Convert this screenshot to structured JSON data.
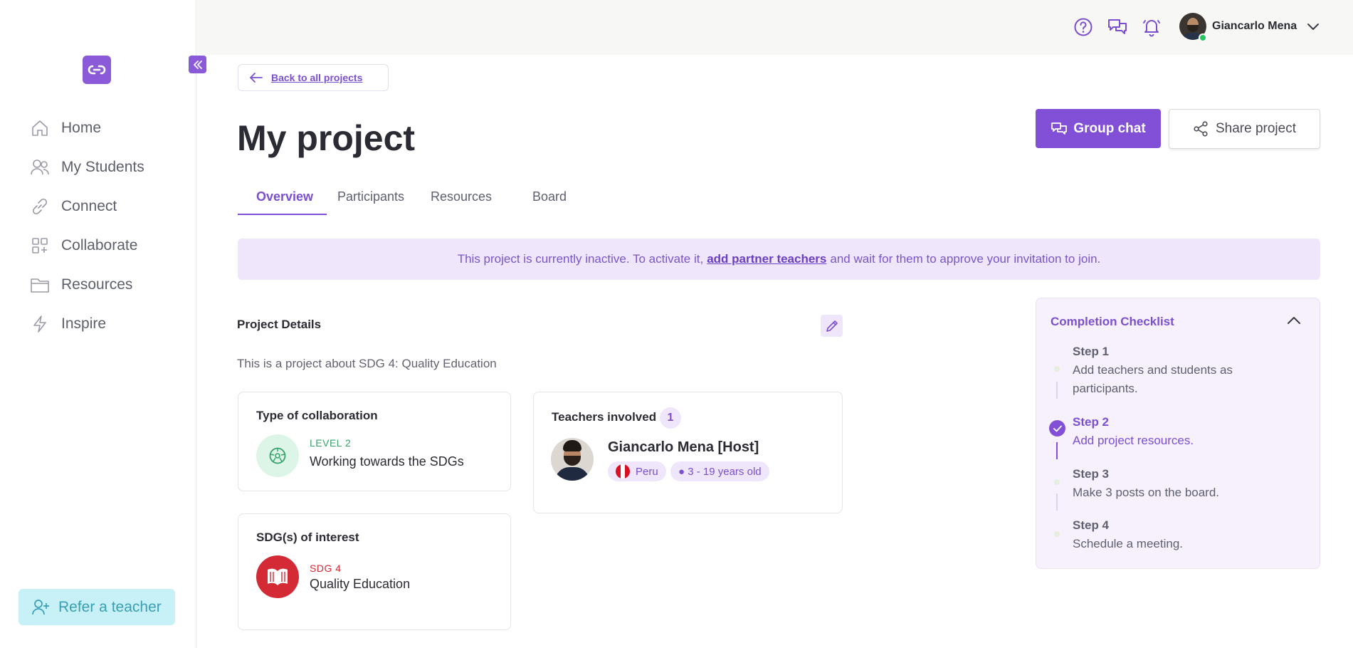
{
  "sidebar": {
    "items": [
      {
        "label": "Home",
        "icon": "home-icon"
      },
      {
        "label": "My Students",
        "icon": "users-icon"
      },
      {
        "label": "Connect",
        "icon": "link-icon"
      },
      {
        "label": "Collaborate",
        "icon": "grid-plus-icon"
      },
      {
        "label": "Resources",
        "icon": "folder-icon"
      },
      {
        "label": "Inspire",
        "icon": "lightning-icon"
      }
    ],
    "refer_label": "Refer a teacher"
  },
  "topbar": {
    "user_name": "Giancarlo Mena"
  },
  "back_label": "Back to all projects",
  "page_title": "My project",
  "actions": {
    "group_chat": "Group chat",
    "share": "Share project"
  },
  "tabs": [
    "Overview",
    "Participants",
    "Resources",
    "Board"
  ],
  "banner": {
    "before": "This project is currently inactive. To activate it,",
    "link": "add partner teachers",
    "after": "and wait for them to approve your invitation to join."
  },
  "details": {
    "title": "Project Details",
    "description": "This is a project about SDG 4: Quality Education",
    "collaboration": {
      "title": "Type of collaboration",
      "level": "LEVEL 2",
      "value": "Working towards the SDGs"
    },
    "sdg": {
      "title": "SDG(s) of interest",
      "code": "SDG 4",
      "value": "Quality Education"
    },
    "teachers": {
      "title": "Teachers involved",
      "count": "1",
      "name": "Giancarlo Mena [Host]",
      "country": "Peru",
      "age": "● 3 - 19 years old"
    }
  },
  "checklist": {
    "title": "Completion Checklist",
    "steps": [
      {
        "title": "Step 1",
        "desc_1": "Add teachers and students as",
        "desc_2": "participants.",
        "done": false
      },
      {
        "title": "Step 2",
        "desc_1": "Add project resources.",
        "done": true
      },
      {
        "title": "Step 3",
        "desc_1": "Make 3 posts on the board.",
        "done": false
      },
      {
        "title": "Step 4",
        "desc_1": "Schedule a meeting.",
        "done": false
      }
    ]
  },
  "colors": {
    "accent": "#8150d6",
    "banner_bg": "#efe6fb",
    "level_green": "#35a36a",
    "sdg_red": "#d32a35"
  }
}
